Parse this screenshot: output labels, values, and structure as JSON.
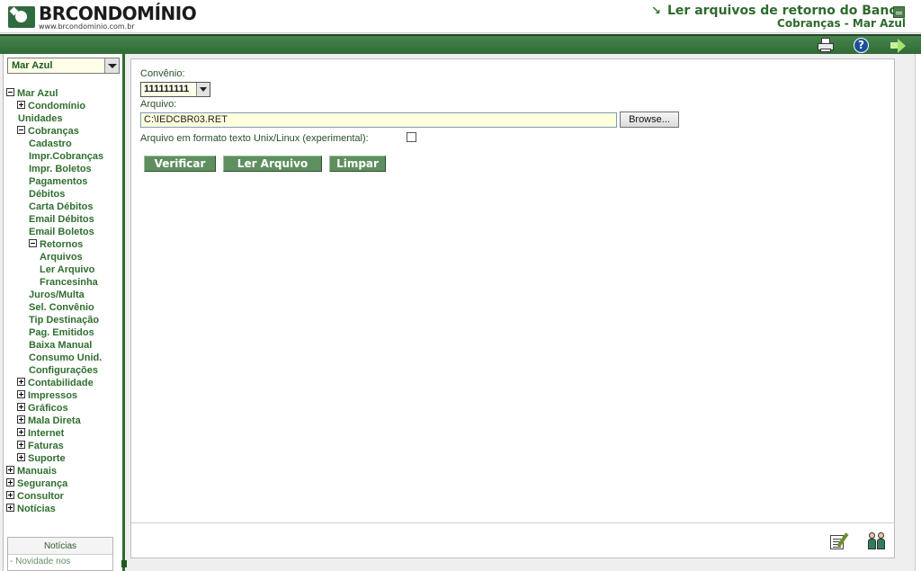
{
  "header": {
    "brand": "BRCONDOMÍNIO",
    "url": "www.brcondominio.com.br",
    "title": "Ler arquivos de retorno do Banco",
    "subtitle": "Cobranças - Mar Azul"
  },
  "toolbar": {
    "icons": [
      "print-icon",
      "help-icon",
      "exit-icon"
    ],
    "help_glyph": "?"
  },
  "sidebar": {
    "condo_selected": "Mar Azul",
    "tree": [
      {
        "label": "Mar Azul",
        "toggle": "minus"
      },
      {
        "label": "Condomínio",
        "toggle": "plus"
      },
      {
        "label": "Unidades"
      },
      {
        "label": "Cobranças",
        "toggle": "minus"
      },
      {
        "label": "Cadastro"
      },
      {
        "label": "Impr.Cobranças"
      },
      {
        "label": "Impr. Boletos"
      },
      {
        "label": "Pagamentos"
      },
      {
        "label": "Débitos"
      },
      {
        "label": "Carta Débitos"
      },
      {
        "label": "Email Débitos"
      },
      {
        "label": "Email Boletos"
      },
      {
        "label": "Retornos",
        "toggle": "minus"
      },
      {
        "label": "Arquivos"
      },
      {
        "label": "Ler Arquivo"
      },
      {
        "label": "Francesinha"
      },
      {
        "label": "Juros/Multa"
      },
      {
        "label": "Sel. Convênio"
      },
      {
        "label": "Tip Destinação"
      },
      {
        "label": "Pag. Emitidos"
      },
      {
        "label": "Baixa Manual"
      },
      {
        "label": "Consumo Unid."
      },
      {
        "label": "Configurações"
      },
      {
        "label": "Contabilidade",
        "toggle": "plus"
      },
      {
        "label": "Impressos",
        "toggle": "plus"
      },
      {
        "label": "Gráficos",
        "toggle": "plus"
      },
      {
        "label": "Mala Direta",
        "toggle": "plus"
      },
      {
        "label": "Internet",
        "toggle": "plus"
      },
      {
        "label": "Faturas",
        "toggle": "plus"
      },
      {
        "label": "Suporte",
        "toggle": "plus"
      },
      {
        "label": "Manuais",
        "toggle": "plus"
      },
      {
        "label": "Segurança",
        "toggle": "plus"
      },
      {
        "label": "Consultor",
        "toggle": "plus"
      },
      {
        "label": "Notícias",
        "toggle": "plus"
      }
    ],
    "news": {
      "title": "Notícias",
      "item": "- Novidade nos"
    }
  },
  "form": {
    "convenio_label": "Convênio:",
    "convenio_value": "111111111",
    "arquivo_label": "Arquivo:",
    "arquivo_value": "C:\\IEDCBR03.RET",
    "browse_label": "Browse...",
    "unix_label": "Arquivo em formato texto Unix/Linux (experimental):",
    "unix_checked": false
  },
  "actions": {
    "verificar": "Verificar",
    "ler_arquivo": "Ler Arquivo",
    "limpar": "Limpar"
  },
  "footer_icons": [
    "edit-notes-icon",
    "users-icon"
  ],
  "colors": {
    "accent_green": "#2e6b2e",
    "button_green": "#5f8f5f",
    "input_bg": "#ffffdd"
  }
}
